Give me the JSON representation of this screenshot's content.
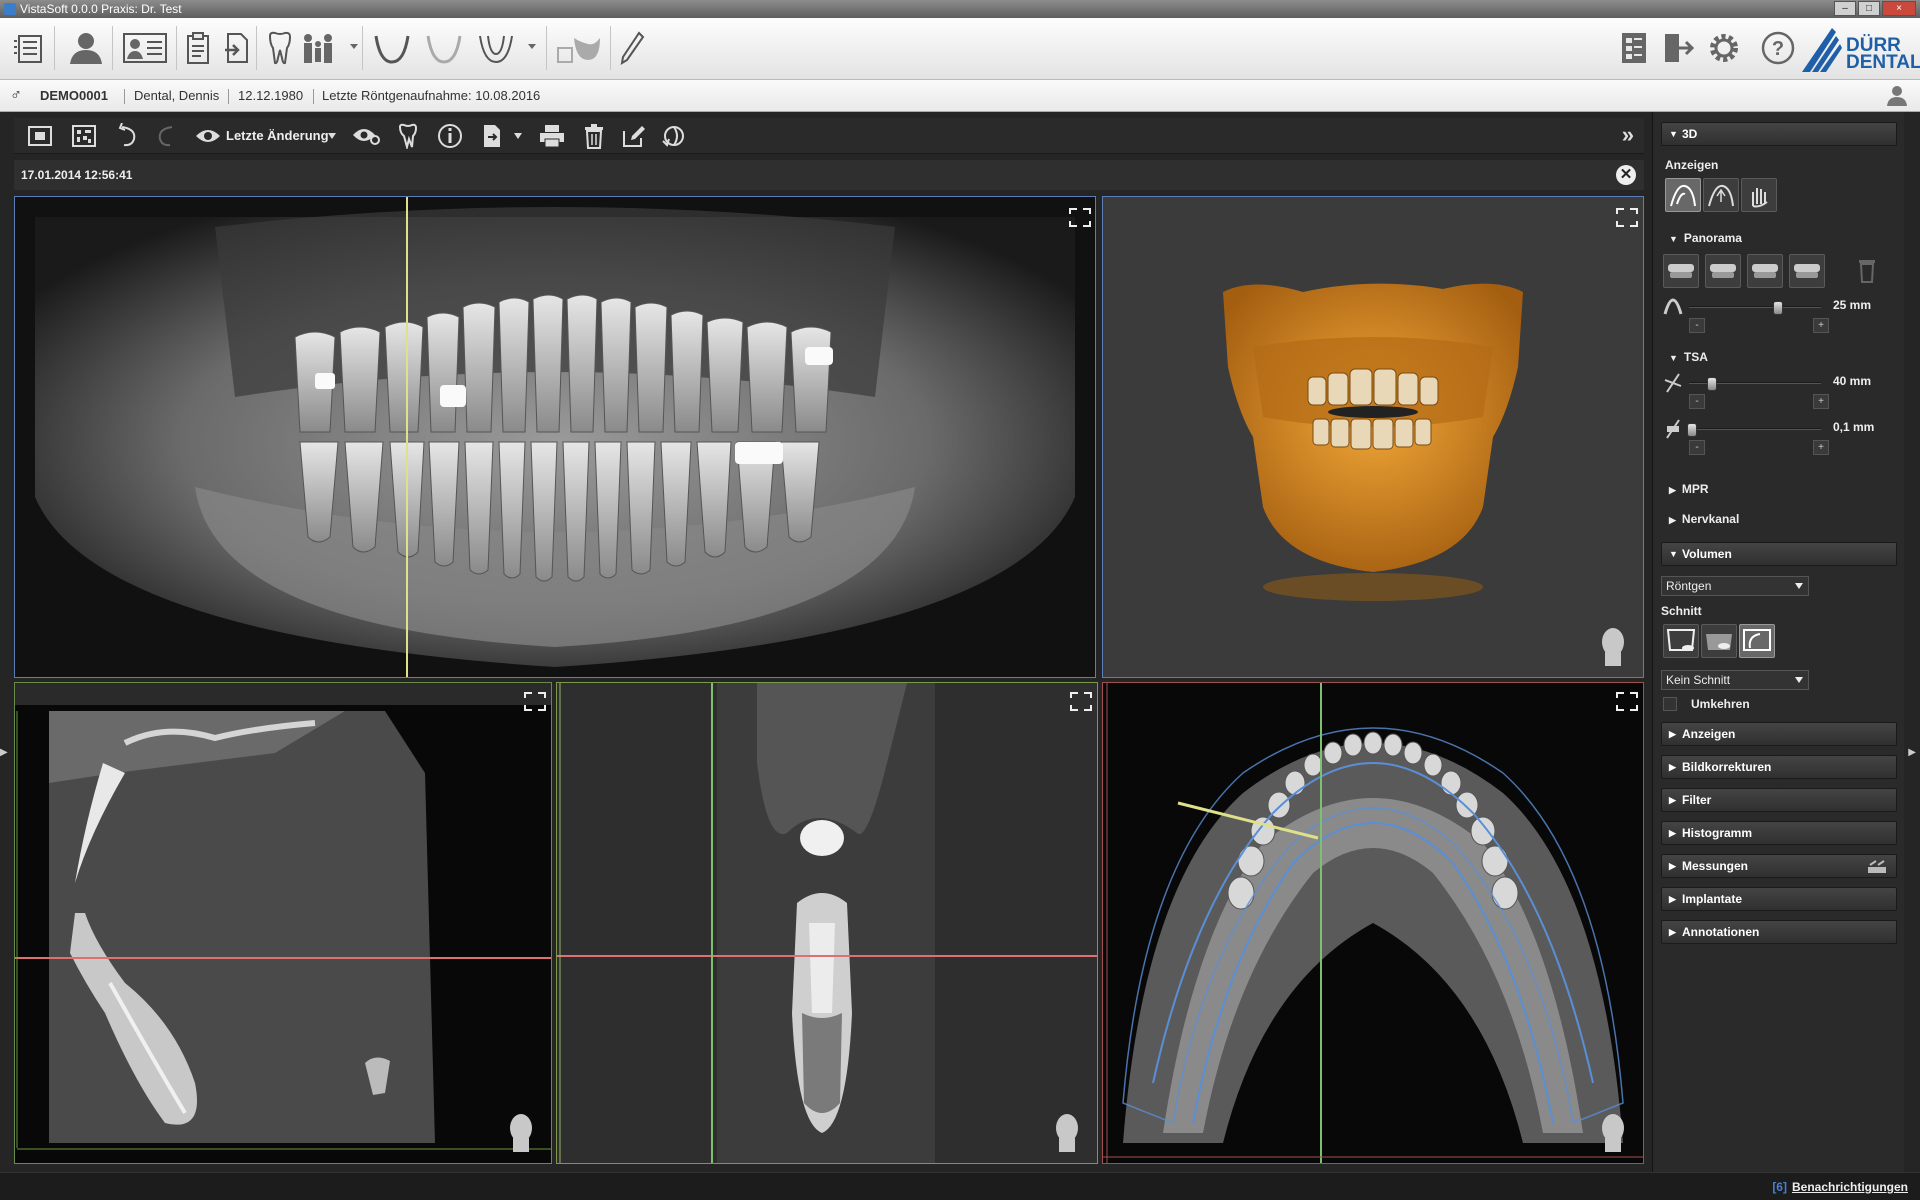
{
  "window": {
    "title": "VistaSoft 0.0.0 Praxis: Dr. Test"
  },
  "logo": {
    "line1": "DÜRR",
    "line2": "DENTAL"
  },
  "main_toolbar": {
    "icons": [
      "list-icon",
      "patient-icon",
      "patient-card-icon",
      "clipboard-icon",
      "import-icon",
      "tooth-icon",
      "family-icon",
      "arch-icon",
      "upper-arch-icon",
      "lower-arch-icon",
      "jaw-3d-icon",
      "pencil-icon"
    ],
    "right_icons": [
      "report-icon",
      "logout-icon",
      "settings-icon",
      "help-icon"
    ]
  },
  "patient": {
    "gender_symbol": "♂",
    "id": "DEMO0001",
    "name": "Dental, Dennis",
    "birthdate": "12.12.1980",
    "last_xray": "Letzte Röntgenaufnahme: 10.08.2016"
  },
  "view_toolbar": {
    "last_change_label": "Letzte Änderung",
    "icons": [
      "capture-icon",
      "qr-icon",
      "undo-icon",
      "redo-icon",
      "eye-icon",
      "eye-settings-icon",
      "tooth-tool-icon",
      "info-icon",
      "export-icon",
      "print-icon",
      "delete-icon",
      "edit-icon",
      "rotate-icon"
    ],
    "expand_symbol": "»"
  },
  "image": {
    "date": "17.01.2014 12:56:41"
  },
  "panel": {
    "header_3d": "3D",
    "anzeigen_label": "Anzeigen",
    "panorama": {
      "title": "Panorama",
      "slider_value": "25 mm"
    },
    "tsa": {
      "title": "TSA",
      "slider1_value": "40 mm",
      "slider2_value": "0,1 mm"
    },
    "mpr": "MPR",
    "nervkanal": "Nervkanal",
    "volumen": {
      "title": "Volumen",
      "mode_select": "Röntgen",
      "schnitt_label": "Schnitt",
      "schnitt_select": "Kein Schnitt",
      "umkehren_label": "Umkehren"
    },
    "sections": [
      "Anzeigen",
      "Bildkorrekturen",
      "Filter",
      "Histogramm",
      "Messungen",
      "Implantate",
      "Annotationen"
    ],
    "plus": "+",
    "minus": "-"
  },
  "status": {
    "count": "[6]",
    "notifications": "Benachrichtigungen"
  },
  "colors": {
    "accent_blue": "#1f5fa8",
    "bone_orange": "#d98a1c",
    "line_yellow": "#dfe08a",
    "line_red": "#e07070",
    "line_green": "#7ec070",
    "arch_blue": "#5a8fd6"
  }
}
